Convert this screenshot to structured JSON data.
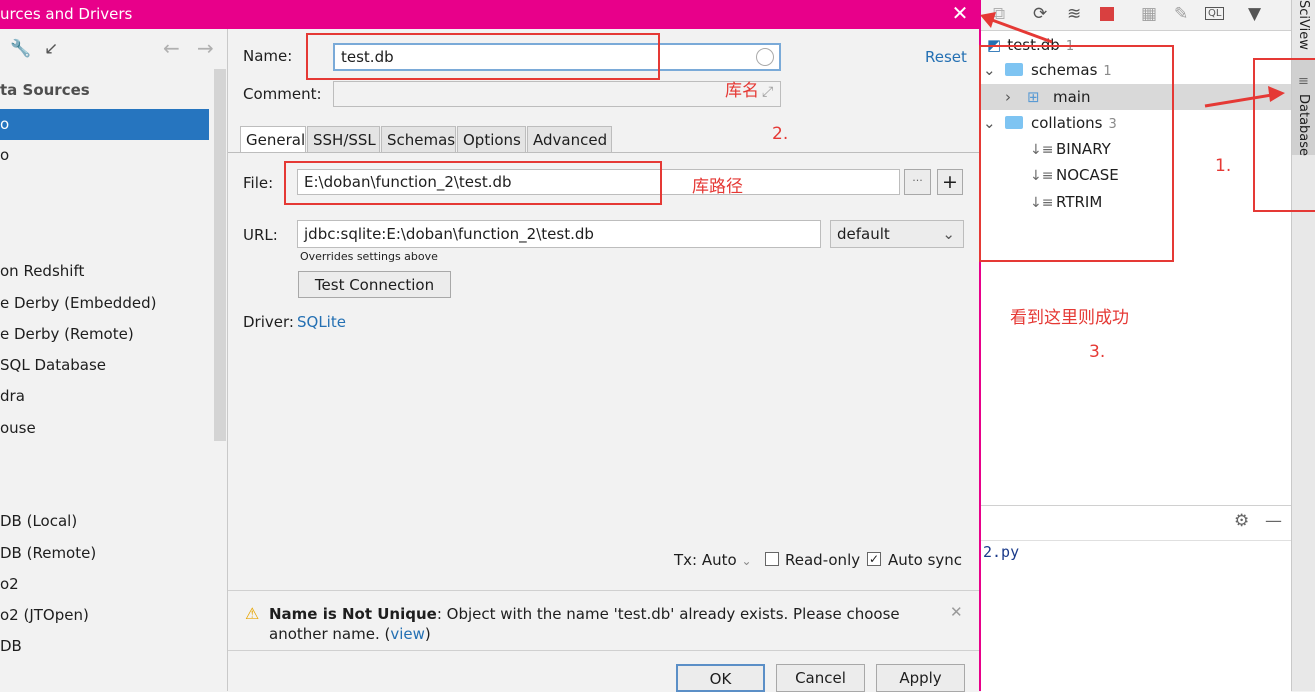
{
  "dialog": {
    "title": "urces and Drivers",
    "close_glyph": "✕",
    "left_panel": {
      "section_header": "ta Sources",
      "items": [
        {
          "label": "o",
          "selected": true
        },
        {
          "label": "o",
          "selected": false
        },
        {
          "label": "on Redshift",
          "selected": false
        },
        {
          "label": "e Derby (Embedded)",
          "selected": false
        },
        {
          "label": "e Derby (Remote)",
          "selected": false
        },
        {
          "label": "SQL Database",
          "selected": false
        },
        {
          "label": "dra",
          "selected": false
        },
        {
          "label": "ouse",
          "selected": false
        },
        {
          "label": "DB (Local)",
          "selected": false
        },
        {
          "label": "DB (Remote)",
          "selected": false
        },
        {
          "label": "o2",
          "selected": false
        },
        {
          "label": "o2 (JTOpen)",
          "selected": false
        },
        {
          "label": "DB",
          "selected": false
        }
      ]
    },
    "form": {
      "name_label": "Name:",
      "name_value": "test.db",
      "reset_link": "Reset",
      "comment_label": "Comment:",
      "tabs": [
        "General",
        "SSH/SSL",
        "Schemas",
        "Options",
        "Advanced"
      ],
      "file_label": "File:",
      "file_value": "E:\\doban\\function_2\\test.db",
      "file_browse": "···",
      "file_add": "+",
      "url_label": "URL:",
      "url_value": "jdbc:sqlite:E:\\doban\\function_2\\test.db",
      "url_mode": "default",
      "url_hint": "Overrides settings above",
      "test_connection": "Test Connection",
      "driver_label": "Driver:",
      "driver_value": "SQLite",
      "tx_label": "Tx: Auto",
      "readonly_label": "Read-only",
      "autosync_label": "Auto sync"
    },
    "warning": {
      "title": "Name is Not Unique",
      "message": ": Object with the name 'test.db' already exists. Please choose",
      "message2": "another name. (",
      "link": "view",
      "tail": ")"
    },
    "buttons": {
      "ok": "OK",
      "cancel": "Cancel",
      "apply": "Apply"
    }
  },
  "annotations": {
    "name_note": "库名",
    "path_note": "库路径",
    "step2": "2.",
    "step1": "1.",
    "step3": "3.",
    "success_note": "看到这里则成功"
  },
  "db_panel": {
    "root": {
      "label": "test.db",
      "count": "1"
    },
    "tree": [
      {
        "label": "schemas",
        "count": "1",
        "kind": "folder",
        "expanded": true
      },
      {
        "label": "main",
        "count": "",
        "kind": "schema",
        "expanded": false
      },
      {
        "label": "collations",
        "count": "3",
        "kind": "folder",
        "expanded": true
      },
      {
        "label": "BINARY",
        "count": "",
        "kind": "collation"
      },
      {
        "label": "NOCASE",
        "count": "",
        "kind": "collation"
      },
      {
        "label": "RTRIM",
        "count": "",
        "kind": "collation"
      }
    ],
    "side_tabs": {
      "sciview": "SciView",
      "database": "Database"
    },
    "editor_text": "2.py"
  },
  "colors": {
    "title_bar": "#e8008a",
    "selection": "#2675bf",
    "annotation": "#e53935",
    "link": "#2470b3"
  }
}
